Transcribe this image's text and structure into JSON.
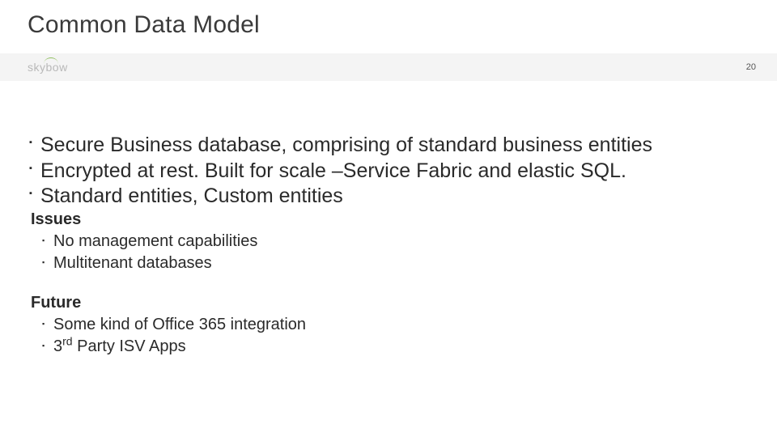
{
  "slide": {
    "title": "Common Data Model",
    "page_number": "20",
    "logo_text": "skybow"
  },
  "main_bullets": [
    "Secure Business database, comprising of standard business entities",
    "Encrypted at rest. Built for scale –Service Fabric and elastic SQL.",
    "Standard entities, Custom entities"
  ],
  "issues": {
    "heading": "Issues",
    "items": [
      "No management capabilities",
      "Multitenant databases"
    ]
  },
  "future": {
    "heading": "Future",
    "items": [
      "Some kind of Office 365 integration",
      "3rd Party ISV Apps"
    ]
  }
}
